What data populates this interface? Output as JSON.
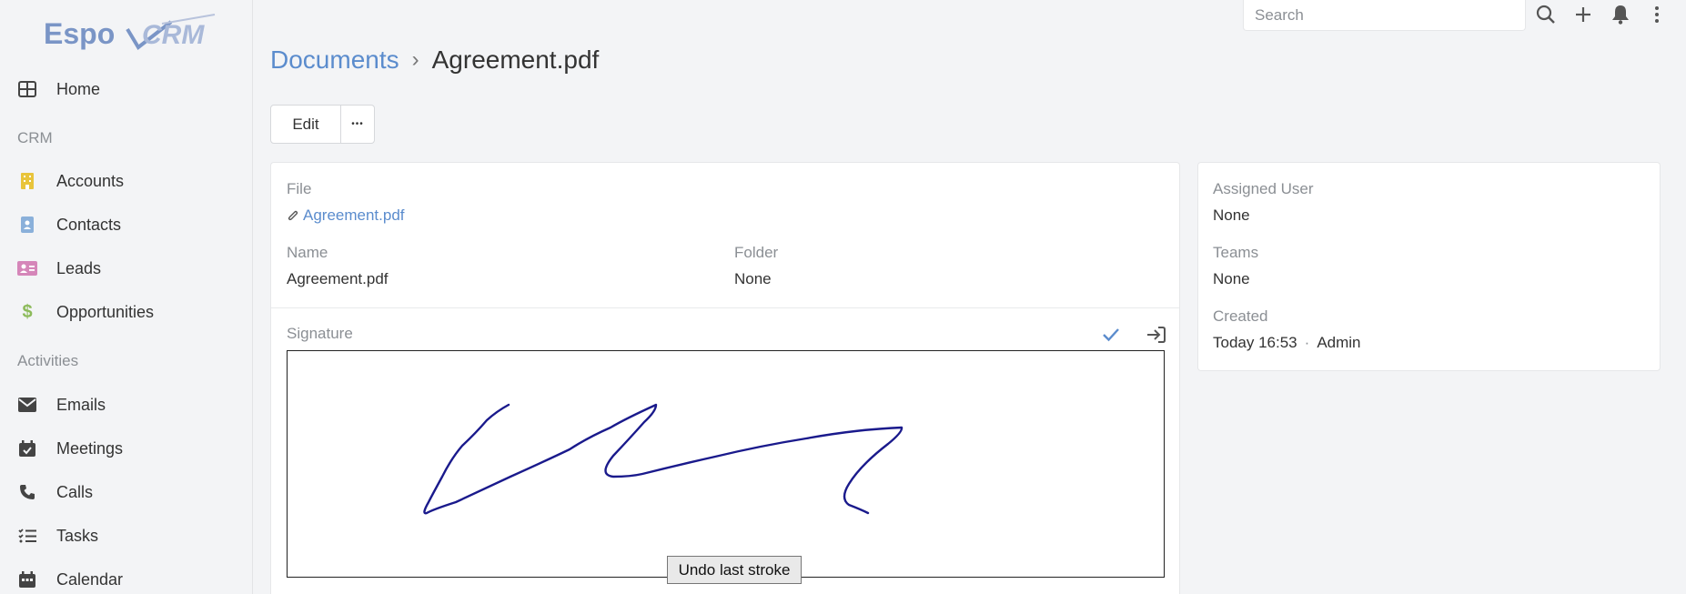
{
  "app": {
    "logo_text": "EspoCRM"
  },
  "sidebar": {
    "home": "Home",
    "groups": {
      "crm": "CRM",
      "activities": "Activities"
    },
    "items": {
      "accounts": "Accounts",
      "contacts": "Contacts",
      "leads": "Leads",
      "opportunities": "Opportunities",
      "emails": "Emails",
      "meetings": "Meetings",
      "calls": "Calls",
      "tasks": "Tasks",
      "calendar": "Calendar"
    },
    "icon_colors": {
      "accounts": "#e8c43b",
      "contacts": "#8ab0da",
      "leads": "#d586b9",
      "opportunities": "#8cba5a",
      "default": "#444444"
    }
  },
  "topbar": {
    "search_placeholder": "Search",
    "icons": [
      "search-icon",
      "plus-icon",
      "bell-icon",
      "kebab-menu-icon"
    ]
  },
  "header": {
    "breadcrumb_parent": "Documents",
    "breadcrumb_separator": "›",
    "title": "Agreement.pdf"
  },
  "actions": {
    "edit": "Edit",
    "more": "•••"
  },
  "record": {
    "file_label": "File",
    "file_value": "Agreement.pdf",
    "name_label": "Name",
    "name_value": "Agreement.pdf",
    "folder_label": "Folder",
    "folder_value": "None",
    "signature_label": "Signature",
    "undo_label": "Undo last stroke"
  },
  "side": {
    "assigned_user_label": "Assigned User",
    "assigned_user_value": "None",
    "teams_label": "Teams",
    "teams_value": "None",
    "created_label": "Created",
    "created_time": "Today 16:53",
    "created_separator": "·",
    "created_by": "Admin"
  },
  "colors": {
    "link": "#5b8ccd",
    "signature_stroke": "#1a1a8c",
    "check": "#5b8ccd"
  }
}
